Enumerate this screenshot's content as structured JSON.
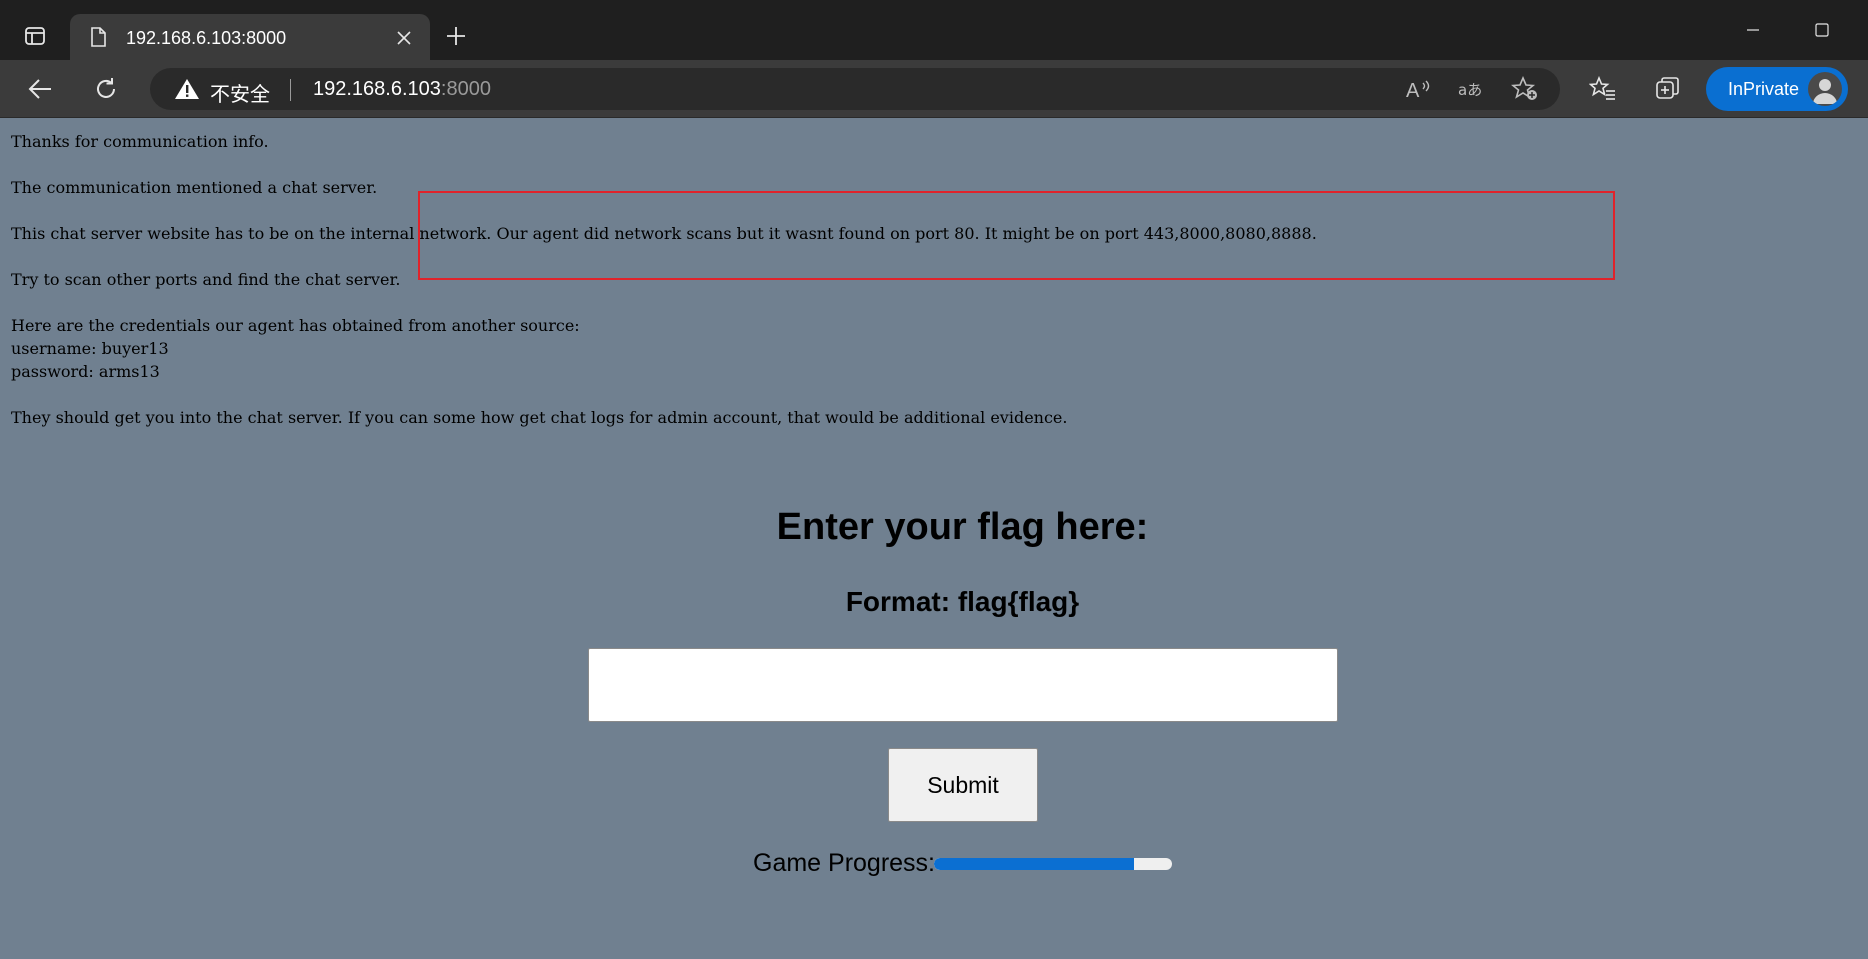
{
  "browser": {
    "tab_title": "192.168.6.103:8000",
    "security_label": "不安全",
    "url_host": "192.168.6.103",
    "url_port": ":8000",
    "inprivate_label": "InPrivate"
  },
  "page": {
    "lines": [
      "Thanks for communication info.",
      "The communication mentioned a chat server.",
      "This chat server website has to be on the internal network. Our agent did network scans but it wasnt found on port 80. It might be on port 443,8000,8080,8888.",
      "Try to scan other ports and find the chat server.",
      "Here are the credentials our agent has obtained from another source:",
      "username: buyer13",
      "password: arms13",
      "They should get you into the chat server. If you can some how get chat logs for admin account, that would be additional evidence."
    ],
    "flag_heading": "Enter your flag here:",
    "flag_format": "Format: flag{flag}",
    "flag_input_value": "",
    "submit_label": "Submit",
    "progress_label": "Game Progress:",
    "progress_fraction": 0.84
  },
  "colors": {
    "page_background": "#708090",
    "accent": "#0b6fd2",
    "highlight": "#e0232b"
  }
}
